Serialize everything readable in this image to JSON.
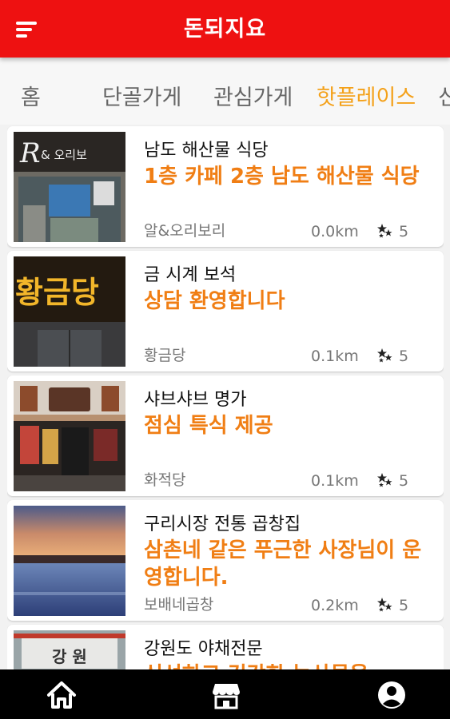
{
  "app": {
    "title": "돈되지요"
  },
  "tabs": [
    {
      "label": "홈",
      "active": false
    },
    {
      "label": "단골가게",
      "active": false
    },
    {
      "label": "관심가게",
      "active": false
    },
    {
      "label": "핫플레이스",
      "active": true
    },
    {
      "label": "신",
      "active": false
    }
  ],
  "colors": {
    "header": "#ee1111",
    "active_tab": "#f4a11a",
    "highlight_text": "#f07e14"
  },
  "places": [
    {
      "title": "남도 해산물 식당",
      "description": "1층 카페 2층 남도 해산물 식당",
      "shop": "알&오리보리",
      "distance": "0.0km",
      "rating": "5",
      "image": "storefront-photo-r-ori"
    },
    {
      "title": "금 시계 보석",
      "description": "상담 환영합니다",
      "shop": "황금당",
      "distance": "0.1km",
      "rating": "5",
      "image": "gold-sign-photo"
    },
    {
      "title": "샤브샤브 명가",
      "description": "점심 특식 제공",
      "shop": "화적당",
      "distance": "0.1km",
      "rating": "5",
      "image": "restaurant-front-photo"
    },
    {
      "title": "구리시장 전통 곱창집",
      "description": "삼촌네 같은 푸근한 사장님이 운영합니다.",
      "shop": "보배네곱창",
      "distance": "0.2km",
      "rating": "5",
      "image": "sunset-pool-photo"
    },
    {
      "title": "강원도 야채전문",
      "description": "신선하고 건강한 농산물을",
      "shop": "",
      "distance": "",
      "rating": "",
      "image": "gangwon-sign-photo"
    }
  ],
  "bottom_nav": [
    {
      "name": "home",
      "icon": "home-icon"
    },
    {
      "name": "store",
      "icon": "store-icon"
    },
    {
      "name": "profile",
      "icon": "profile-icon"
    }
  ]
}
